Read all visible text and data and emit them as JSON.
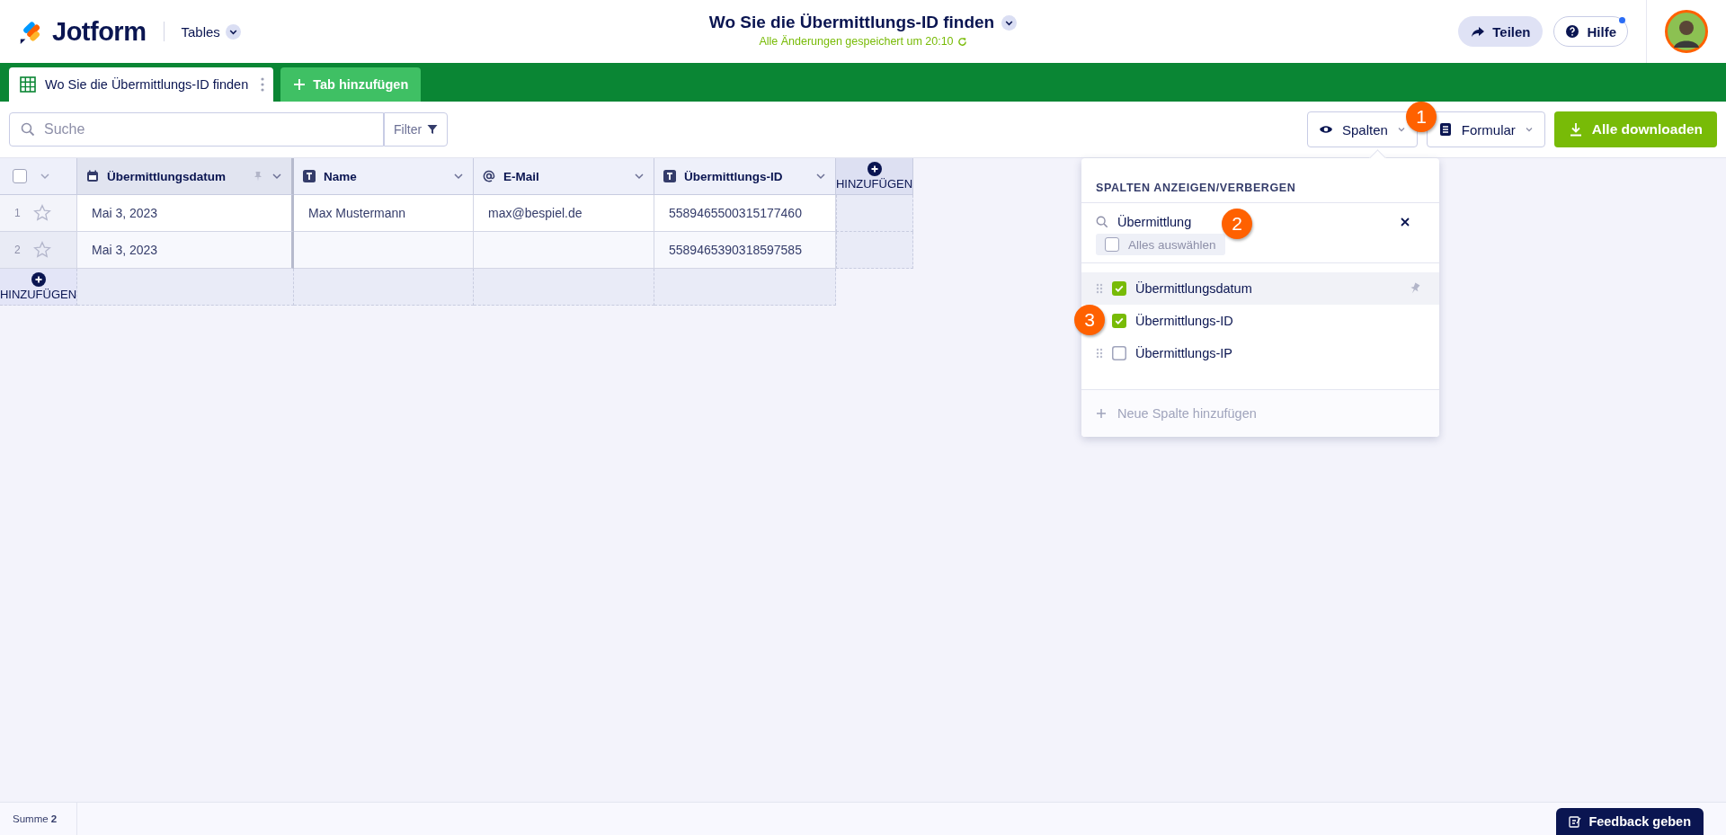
{
  "header": {
    "logo": "Jotform",
    "app_switch": "Tables",
    "title": "Wo Sie die Übermittlungs-ID finden",
    "saved_note": "Alle Änderungen gespeichert um 20:10",
    "share": "Teilen",
    "help": "Hilfe",
    "help_notification": true
  },
  "tabs": [
    {
      "label": "Wo Sie die Übermittlungs-ID finden",
      "selected": true
    }
  ],
  "add_tab": "Tab hinzufügen",
  "toolbar": {
    "search_placeholder": "Suche",
    "filter": "Filter",
    "columns_button": "Spalten",
    "form_button": "Formular",
    "download_button": "Alle downloaden"
  },
  "table": {
    "columns": [
      {
        "label": "Übermittlungsdatum",
        "kind": "date",
        "pinned": true
      },
      {
        "label": "Name",
        "kind": "text",
        "pinned": false
      },
      {
        "label": "E-Mail",
        "kind": "email",
        "pinned": false
      },
      {
        "label": "Übermittlungs-ID",
        "kind": "text",
        "pinned": false
      }
    ],
    "add_column": "HINZUFÜGEN",
    "all_rows_checked": false,
    "rows": [
      {
        "number": "1",
        "cells": [
          "Mai 3, 2023",
          "Max Mustermann",
          "max@bespiel.de",
          "5589465500315177460"
        ]
      },
      {
        "number": "2",
        "cells": [
          "Mai 3, 2023",
          "",
          "",
          "5589465390318597585"
        ]
      }
    ],
    "add_row": "HINZUFÜGEN"
  },
  "columns_menu": {
    "title": "SPALTEN ANZEIGEN/VERBERGEN",
    "search_value": "Übermittlung",
    "select_all": "Alles auswählen",
    "select_all_checked": false,
    "items": [
      {
        "label": "Übermittlungsdatum",
        "checked": true,
        "pinned": true,
        "selected": true,
        "drag_handle": true
      },
      {
        "label": "Übermittlungs-ID",
        "checked": true,
        "pinned": false,
        "selected": false,
        "drag_handle": false
      },
      {
        "label": "Übermittlungs-IP",
        "checked": false,
        "pinned": false,
        "selected": false,
        "drag_handle": true
      }
    ],
    "new_column": "Neue Spalte hinzufügen"
  },
  "callouts": [
    "1",
    "2",
    "3"
  ],
  "footer": {
    "sum": "Summe **2**",
    "feedback": "Feedback geben"
  }
}
